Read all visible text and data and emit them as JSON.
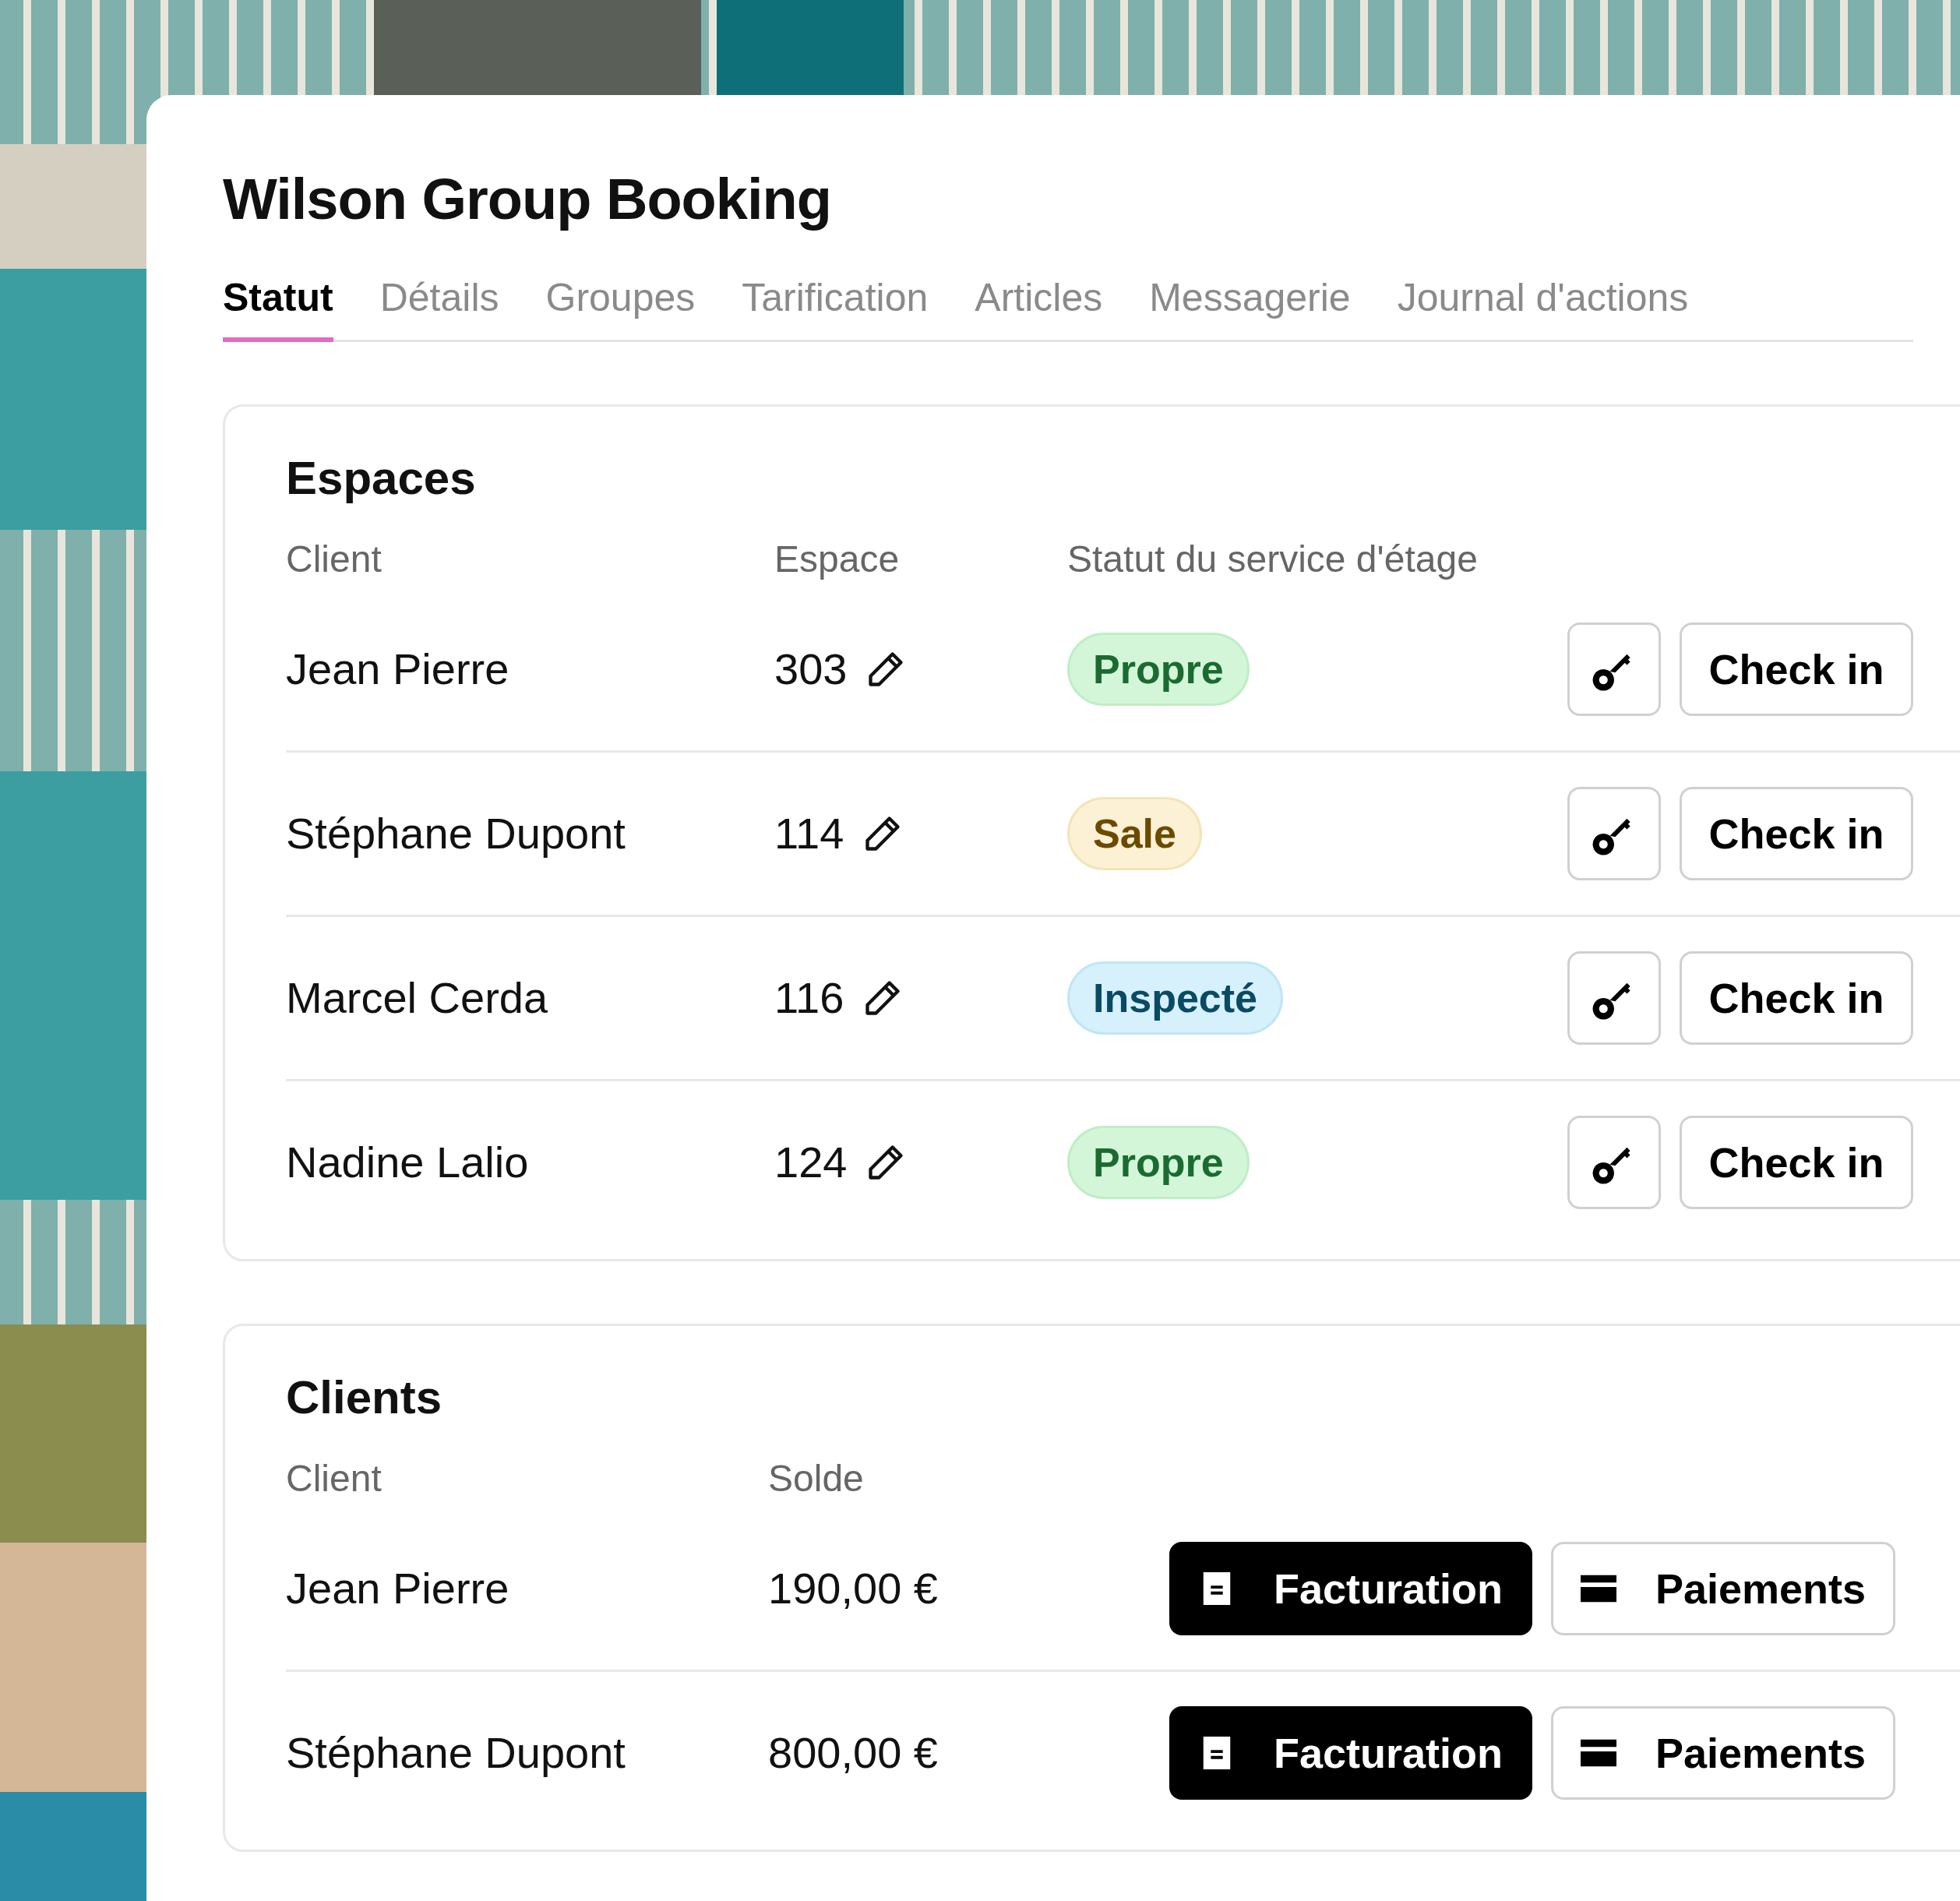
{
  "title": "Wilson Group Booking",
  "tabs": [
    {
      "label": "Statut",
      "selected": true
    },
    {
      "label": "Détails",
      "selected": false
    },
    {
      "label": "Groupes",
      "selected": false
    },
    {
      "label": "Tarification",
      "selected": false
    },
    {
      "label": "Articles",
      "selected": false
    },
    {
      "label": "Messagerie",
      "selected": false
    },
    {
      "label": "Journal d'actions",
      "selected": false
    }
  ],
  "spaces": {
    "heading": "Espaces",
    "columns": [
      "Client",
      "Espace",
      "Statut du service d'étage"
    ],
    "rows": [
      {
        "client": "Jean Pierre",
        "space": "303",
        "status": {
          "label": "Propre",
          "kind": "clean"
        },
        "action": "Check in"
      },
      {
        "client": "Stéphane Dupont",
        "space": "114",
        "status": {
          "label": "Sale",
          "kind": "dirty"
        },
        "action": "Check in"
      },
      {
        "client": "Marcel Cerda",
        "space": "116",
        "status": {
          "label": "Inspecté",
          "kind": "inspected"
        },
        "action": "Check in"
      },
      {
        "client": "Nadine Lalio",
        "space": "124",
        "status": {
          "label": "Propre",
          "kind": "clean"
        },
        "action": "Check in"
      }
    ]
  },
  "clients": {
    "heading": "Clients",
    "columns": [
      "Client",
      "Solde"
    ],
    "rows": [
      {
        "client": "Jean Pierre",
        "balance": "190,00 €",
        "billing": "Facturation",
        "payments": "Paiements"
      },
      {
        "client": "Stéphane Dupont",
        "balance": "800,00 €",
        "billing": "Facturation",
        "payments": "Paiements"
      }
    ]
  }
}
